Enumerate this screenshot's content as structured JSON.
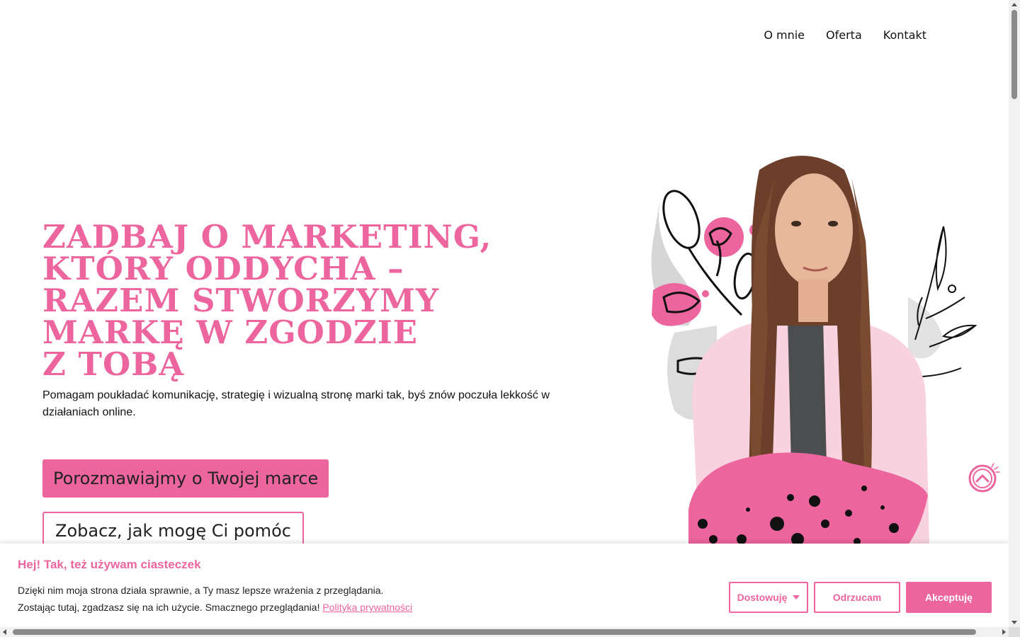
{
  "nav": {
    "items": [
      "O mnie",
      "Oferta",
      "Kontakt"
    ]
  },
  "hero": {
    "title_lines": [
      "ZADBAJ O MARKETING,",
      "KTÓRY ODDYCHA –",
      "RAZEM STWORZYMY",
      "MARKĘ W ZGODZIE",
      "Z TOBĄ"
    ],
    "subtitle": "Pomagam poukładać komunikację, strategię i wizualną stronę marki tak, byś znów poczuła lekkość w działaniach online.",
    "primary_cta": "Porozmawiajmy o Twojej marce",
    "secondary_cta": "Zobacz, jak mogę Ci pomóc"
  },
  "cookie": {
    "title": "Hej! Tak, też używam ciasteczek",
    "line1": "Dzięki nim moja strona działa sprawnie, a Ty masz lepsze wrażenia z przeglądania.",
    "line2": "Zostając tutaj, zgadzasz się na ich użycie. Smacznego przeglądania!",
    "policy_link": "Polityka prywatności",
    "customize_label": "Dostowuję",
    "reject_label": "Odrzucam",
    "accept_label": "Akceptuję"
  },
  "colors": {
    "accent": "#ec659f",
    "text": "#111111"
  }
}
